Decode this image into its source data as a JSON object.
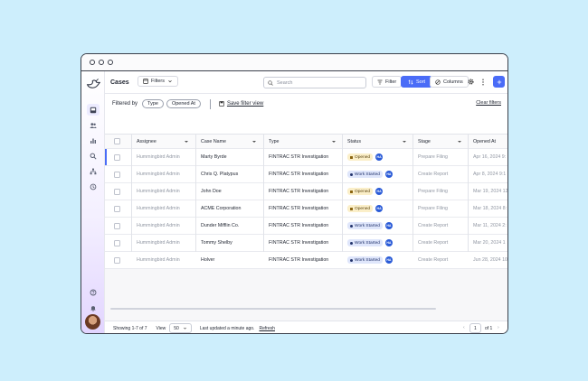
{
  "header": {
    "title": "Cases",
    "filters_label": "Filters",
    "search_placeholder": "Search",
    "filter_label": "Filter",
    "sort_label": "Sort",
    "columns_label": "Columns"
  },
  "filterbar": {
    "filtered_by": "Filtered by",
    "chips": [
      "Type",
      "Opened At"
    ],
    "save_label": "Save filter view",
    "clear_label": "Clear filters"
  },
  "table": {
    "columns": [
      "Assignee",
      "Case Name",
      "Type",
      "Status",
      "Stage",
      "Opened At"
    ],
    "rows": [
      {
        "assignee": "Hummingbird Admin",
        "case": "Marty Byrde",
        "type": "FINTRAC STR Investigation",
        "status": "Opened",
        "stage": "Prepare Filing",
        "opened": "Apr 16, 2024 9:"
      },
      {
        "assignee": "Hummingbird Admin",
        "case": "Chris Q. Platypus",
        "type": "FINTRAC STR Investigation",
        "status": "Work Started",
        "stage": "Create Report",
        "opened": "Apr 8, 2024 9:1"
      },
      {
        "assignee": "Hummingbird Admin",
        "case": "John Doe",
        "type": "FINTRAC STR Investigation",
        "status": "Opened",
        "stage": "Prepare Filing",
        "opened": "Mar 19, 2024 12"
      },
      {
        "assignee": "Hummingbird Admin",
        "case": "ACME Corporation",
        "type": "FINTRAC STR Investigation",
        "status": "Opened",
        "stage": "Prepare Filing",
        "opened": "Mar 18, 2024 8:"
      },
      {
        "assignee": "Hummingbird Admin",
        "case": "Dunder Mifflin Co.",
        "type": "FINTRAC STR Investigation",
        "status": "Work Started",
        "stage": "Create Report",
        "opened": "Mar 11, 2024 2:"
      },
      {
        "assignee": "Hummingbird Admin",
        "case": "Tommy Shelby",
        "type": "FINTRAC STR Investigation",
        "status": "Work Started",
        "stage": "Create Report",
        "opened": "Mar 20, 2024 1"
      },
      {
        "assignee": "Hummingbird Admin",
        "case": "Holver",
        "type": "FINTRAC STR Investigation",
        "status": "Work Started",
        "stage": "Create Report",
        "opened": "Jun 28, 2024 10"
      }
    ]
  },
  "footer": {
    "showing": "Showing 1-7 of 7",
    "view_label": "View",
    "page_size": "50",
    "updated": "Last updated a minute ago.",
    "refresh": "Refresh",
    "page": "1",
    "of_pages": "of 1"
  },
  "avatar_initials": "HA",
  "colors": {
    "accent": "#4a6cf7",
    "opened": "#fbefc9",
    "work_started": "#dfe6fb",
    "background": "#cdeefc"
  },
  "icons": [
    "bird-logo-icon",
    "inbox-icon",
    "users-icon",
    "bar-chart-icon",
    "search-icon",
    "hierarchy-icon",
    "history-icon",
    "help-icon",
    "bell-icon",
    "filter-icon",
    "sort-icon",
    "columns-icon",
    "gear-icon",
    "more-icon",
    "plus-icon",
    "save-icon"
  ]
}
